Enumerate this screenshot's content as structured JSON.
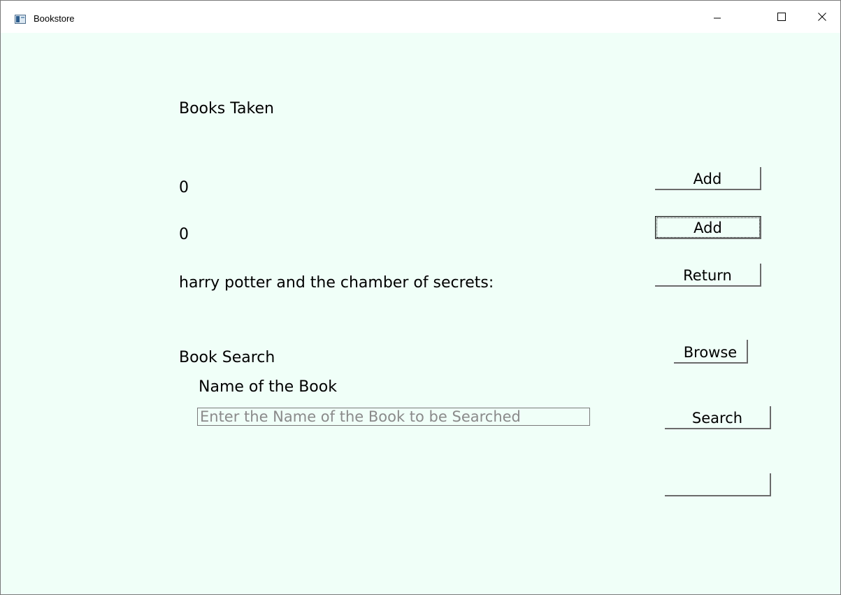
{
  "window": {
    "title": "Bookstore"
  },
  "icons": {
    "app": "app-window-icon",
    "minimize": "minimize-icon",
    "maximize": "maximize-icon",
    "close": "close-icon"
  },
  "colors": {
    "background": "#f0fff8",
    "titlebar": "#ffffff"
  },
  "labels": {
    "books_taken": "Books Taken",
    "count_1": "0",
    "count_2": "0",
    "borrowed_book": "harry potter and the chamber of secrets:",
    "book_search": "Book Search",
    "name_of_book": "Name of the Book"
  },
  "buttons": {
    "add_1": "Add",
    "add_2": "Add",
    "return": "Return",
    "browse": "Browse",
    "search": "Search",
    "blank": ""
  },
  "search": {
    "value": "",
    "placeholder": "Enter the Name of the Book to be Searched"
  }
}
